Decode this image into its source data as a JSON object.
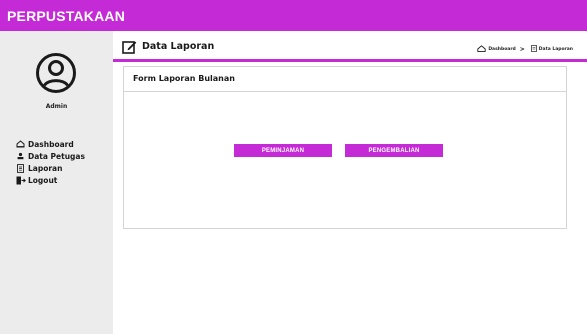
{
  "app": {
    "brand": "PERPUSTAKAAN"
  },
  "sidebar": {
    "user_name": "Admin",
    "items": [
      {
        "label": "Dashboard",
        "icon": "home-icon"
      },
      {
        "label": "Data Petugas",
        "icon": "user-icon"
      },
      {
        "label": "Laporan",
        "icon": "file-icon"
      },
      {
        "label": "Logout",
        "icon": "logout-icon"
      }
    ]
  },
  "header": {
    "title": "Data Laporan",
    "title_icon": "edit-icon",
    "breadcrumb": [
      "Dashboard",
      "Data Laporan"
    ]
  },
  "card": {
    "title": "Form Laporan Bulanan",
    "buttons": {
      "peminjaman": "PEMINJAMAN",
      "pengembalian": "PENGEMBALIAN"
    }
  },
  "colors": {
    "accent": "#c42bd6",
    "sidebar_bg": "#ececec"
  }
}
